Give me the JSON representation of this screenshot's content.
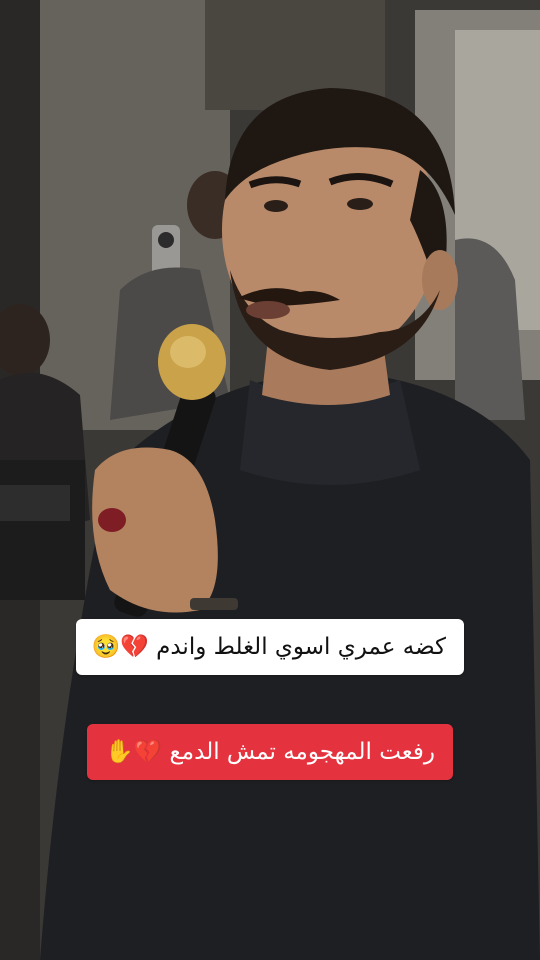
{
  "video": {
    "description_icon": "video-frame"
  },
  "captions": [
    {
      "text": "كضه عمري اسوي الغلط واندم 💔🥹",
      "background": "#ffffff",
      "color": "#111111"
    },
    {
      "text": "رفعت المهجومه تمش الدمع 💔✋",
      "background": "#e5323f",
      "color": "#ffffff"
    }
  ],
  "colors": {
    "caption_red": "#e5323f",
    "caption_white": "#ffffff"
  }
}
